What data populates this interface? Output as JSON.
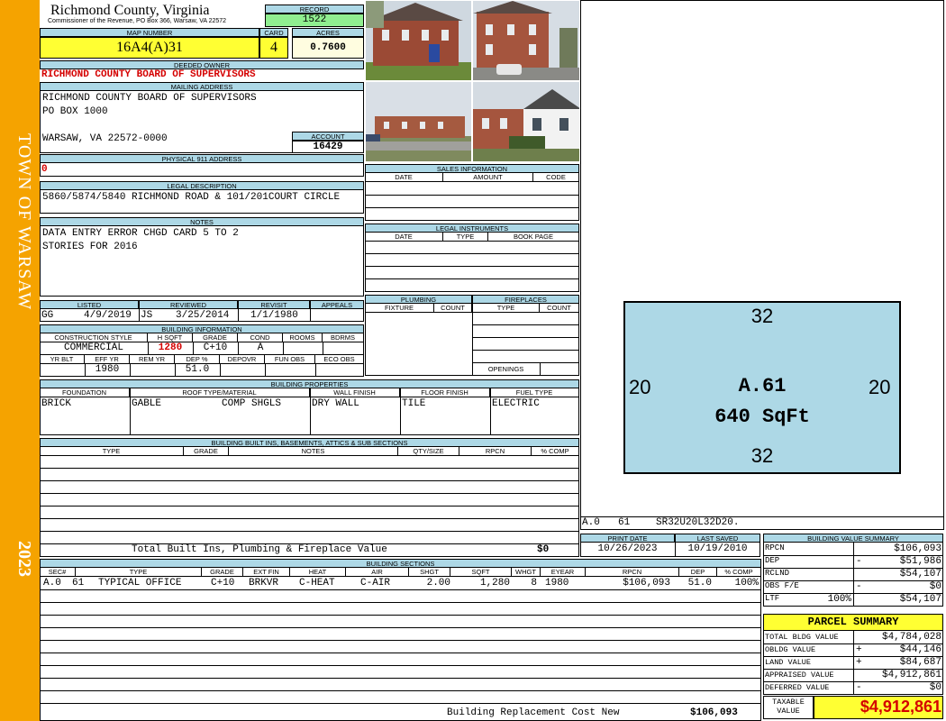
{
  "sidebar": {
    "town": "TOWN OF WARSAW",
    "year": "2023"
  },
  "header": {
    "county": "Richmond County, Virginia",
    "commissioner": "Commissioner of the Revenue, PO Box 366, Warsaw, VA 22572",
    "record_label": "RECORD",
    "record": "1522",
    "map_label": "MAP NUMBER",
    "map_number": "16A4(A)31",
    "card_label": "CARD",
    "card": "4",
    "acres_label": "ACRES",
    "acres": "0.7600"
  },
  "owner": {
    "deeded_label": "DEEDED OWNER",
    "deeded": "RICHMOND COUNTY BOARD OF SUPERVISORS",
    "mailing_label": "MAILING ADDRESS",
    "mail1": "RICHMOND COUNTY BOARD OF SUPERVISORS",
    "mail2": "PO BOX  1000",
    "mail3": "WARSAW, VA 22572-0000",
    "account_label": "ACCOUNT",
    "account": "16429",
    "phys_label": "PHYSICAL 911 ADDRESS",
    "phys": "0"
  },
  "legal": {
    "label": "LEGAL DESCRIPTION",
    "text": "5860/5874/5840 RICHMOND ROAD & 101/201COURT CIRCLE"
  },
  "notes": {
    "label": "NOTES",
    "line1": "DATA ENTRY ERROR CHGD CARD 5 TO 2",
    "line2": "STORIES FOR 2016"
  },
  "dates": {
    "listed_label": "LISTED",
    "listed_by": "GG",
    "listed": "4/9/2019",
    "reviewed_label": "REVIEWED",
    "reviewed_by": "JS",
    "reviewed": "3/25/2014",
    "revisit_label": "REVISIT",
    "revisit": "1/1/1980",
    "appeals_label": "APPEALS"
  },
  "building_info": {
    "label": "BUILDING INFORMATION",
    "h_style": "CONSTRUCTION STYLE",
    "h_sqft": "H SQFT",
    "h_grade": "GRADE",
    "h_cond": "COND",
    "h_rooms": "ROOMS",
    "h_bdrms": "BDRMS",
    "style": "COMMERCIAL",
    "sqft": "1280",
    "grade": "C+10",
    "cond": "A",
    "h_yrblt": "YR BLT",
    "h_effyr": "EFF YR",
    "h_remyr": "REM YR",
    "h_dep": "DEP %",
    "h_depovr": "DEPOVR",
    "h_funobs": "FUN OBS",
    "h_ecoobs": "ECO OBS",
    "effyr": "1980",
    "dep": "51.0"
  },
  "sales": {
    "label": "SALES INFORMATION",
    "h_date": "DATE",
    "h_amount": "AMOUNT",
    "h_code": "CODE"
  },
  "legal_instruments": {
    "label": "LEGAL INSTRUMENTS",
    "h_date": "DATE",
    "h_type": "TYPE",
    "h_book": "BOOK PAGE"
  },
  "plumbing": {
    "label": "PLUMBING",
    "h_fixture": "FIXTURE",
    "h_count": "COUNT"
  },
  "fireplaces": {
    "label": "FIREPLACES",
    "h_type": "TYPE",
    "h_count": "COUNT",
    "openings": "OPENINGS"
  },
  "properties": {
    "label": "BUILDING PROPERTIES",
    "h_foundation": "FOUNDATION",
    "h_roof": "ROOF TYPE/MATERIAL",
    "h_wall": "WALL FINISH",
    "h_floor": "FLOOR FINISH",
    "h_fuel": "FUEL TYPE",
    "foundation": "BRICK",
    "roof_type": "GABLE",
    "roof_material": "COMP SHGLS",
    "wall": "DRY WALL",
    "floor": "TILE",
    "fuel": "ELECTRIC"
  },
  "builtins": {
    "label": "BUILDING BUILT INS, BASEMENTS, ATTICS & SUB SECTIONS",
    "h_type": "TYPE",
    "h_grade": "GRADE",
    "h_notes": "NOTES",
    "h_qty": "QTY/SIZE",
    "h_rpcn": "RPCN",
    "h_comp": "% COMP",
    "total_label": "Total Built Ins, Plumbing & Fireplace Value",
    "total": "$0"
  },
  "sketch": {
    "top": "32",
    "bottom": "32",
    "left": "20",
    "right": "20",
    "section": "A.61",
    "area": "640 SqFt",
    "caption_sec": "A.0",
    "caption_code": "61",
    "caption_path": "SR32U20L32D20."
  },
  "print": {
    "print_label": "PRINT DATE",
    "print_date": "10/26/2023",
    "saved_label": "LAST SAVED",
    "saved_date": "10/19/2010"
  },
  "sections": {
    "label": "BUILDING SECTIONS",
    "headers": [
      "SEC#",
      "TYPE",
      "GRADE",
      "EXT FIN",
      "HEAT",
      "AIR",
      "SHGT",
      "SQFT",
      "WHGT",
      "EYEAR",
      "RPCN",
      "DEP",
      "% COMP"
    ],
    "row": {
      "sec": "A.0",
      "code": "61",
      "type": "TYPICAL OFFICE",
      "grade": "C+10",
      "extfin": "BRKVR",
      "heat": "C-HEAT",
      "air": "C-AIR",
      "shgt": "2.00",
      "sqft": "1,280",
      "whgt": "8",
      "eyear": "1980",
      "rpcn": "$106,093",
      "dep": "51.0",
      "comp": "100%"
    },
    "brcn_label": "Building Replacement Cost New",
    "brcn": "$106,093"
  },
  "value_summary": {
    "label": "BUILDING VALUE SUMMARY",
    "rpcn_label": "RPCN",
    "rpcn": "$106,093",
    "dep_label": "DEP",
    "dep_sign": "-",
    "dep": "$51,986",
    "rclnd_label": "RCLND",
    "rclnd": "$54,107",
    "obs_label": "OBS F/E",
    "obs_sign": "-",
    "obs": "$0",
    "ltf_label": "LTF",
    "ltf_pct": "100%",
    "ltf": "$54,107"
  },
  "parcel": {
    "label": "PARCEL SUMMARY",
    "total_label": "TOTAL BLDG VALUE",
    "total": "$4,784,028",
    "obldg_label": "OBLDG VALUE",
    "obldg_sign": "+",
    "obldg": "$44,146",
    "land_label": "LAND VALUE",
    "land_sign": "+",
    "land": "$84,687",
    "appraised_label": "APPRAISED VALUE",
    "appraised": "$4,912,861",
    "deferred_label": "DEFERRED VALUE",
    "deferred_sign": "-",
    "deferred": "$0",
    "taxable_label1": "TAXABLE",
    "taxable_label2": "VALUE",
    "taxable": "$4,912,861"
  }
}
